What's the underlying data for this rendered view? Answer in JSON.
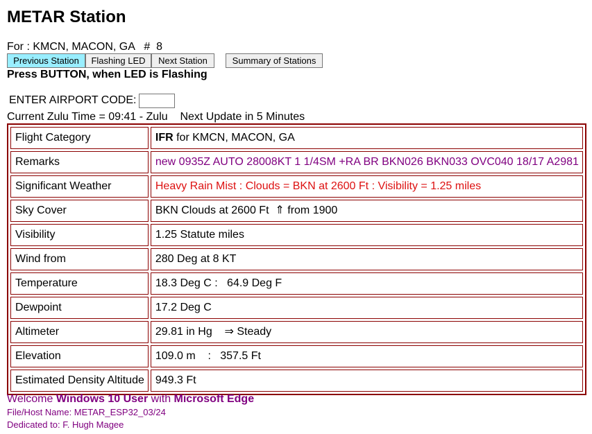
{
  "page_title": "METAR Station",
  "station": {
    "for_label": "For : KMCN, MACON, GA   #  8"
  },
  "buttons": {
    "previous": "Previous Station",
    "flashing": "Flashing LED",
    "next": "Next Station",
    "summary": "Summary of Stations"
  },
  "press_instruction": "Press BUTTON, when LED is Flashing",
  "airport_code": {
    "label": "ENTER AIRPORT CODE:",
    "value": ""
  },
  "zulu_line": "Current Zulu Time = 09:41 - Zulu    Next Update in 5 Minutes",
  "table": {
    "rows": [
      {
        "label": "Flight Category",
        "value_bold": "IFR",
        "value": " for KMCN, MACON, GA"
      },
      {
        "label": "Remarks",
        "value": "new 0935Z AUTO 28008KT 1 1/4SM +RA BR BKN026 BKN033 OVC040 18/17 A2981",
        "color": "#800080"
      },
      {
        "label": "Significant Weather",
        "value": "Heavy Rain Mist : Clouds = BKN at 2600 Ft : Visibility = 1.25 miles",
        "color": "#dd1111"
      },
      {
        "label": "Sky Cover",
        "value": "BKN Clouds at 2600 Ft  ⇑ from 1900"
      },
      {
        "label": "Visibility",
        "value": "1.25 Statute miles"
      },
      {
        "label": "Wind from",
        "value": "280 Deg at 8 KT"
      },
      {
        "label": "Temperature",
        "value": "18.3 Deg C :   64.9 Deg F"
      },
      {
        "label": "Dewpoint",
        "value": "17.2 Deg C"
      },
      {
        "label": "Altimeter",
        "value": "29.81 in Hg    ⇒ Steady"
      },
      {
        "label": "Elevation",
        "value": "109.0 m    :   357.5 Ft"
      },
      {
        "label": "Estimated Density Altitude",
        "value": "949.3 Ft"
      }
    ]
  },
  "footer": {
    "welcome_prefix": "Welcome ",
    "user": "Windows 10 User",
    "with": " with ",
    "browser": "Microsoft Edge",
    "file_host": "File/Host Name: METAR_ESP32_03/24",
    "dedicated": "Dedicated to: F. Hugh Magee"
  },
  "colors": {
    "table_border": "#8b0000",
    "active_button": "#99eeff",
    "remarks_text": "#800080",
    "weather_text": "#dd1111"
  }
}
